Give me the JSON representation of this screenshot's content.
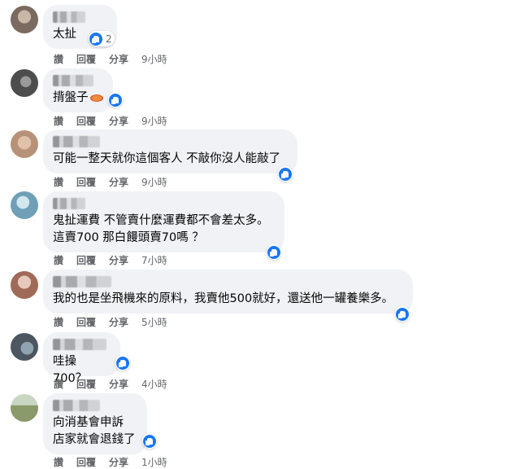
{
  "comments": [
    {
      "text": "太扯",
      "reaction_count": "2",
      "actions": {
        "like": "讚",
        "reply": "回覆",
        "share": "分享",
        "time": "9小時"
      },
      "avatar_color": "#7a6a60"
    },
    {
      "text": "揹盤子",
      "emoji": "plate-icon",
      "actions": {
        "like": "讚",
        "reply": "回覆",
        "share": "分享",
        "time": "9小時"
      },
      "avatar_color": "#5b5b5b"
    },
    {
      "text": "可能一整天就你這個客人 不敲你沒人能敲了",
      "actions": {
        "like": "讚",
        "reply": "回覆",
        "share": "分享",
        "time": "9小時"
      },
      "avatar_color": "#b89278"
    },
    {
      "text": "鬼扯運費 不管賣什麼運費都不會差太多。\n這賣700 那白饅頭賣70嗎 ？",
      "actions": {
        "like": "讚",
        "reply": "回覆",
        "share": "分享",
        "time": "7小時"
      },
      "avatar_color": "#6fa0b8"
    },
    {
      "text": "我的也是坐飛機來的原料，我賣他500就好，還送他一罐養樂多。",
      "actions": {
        "like": "讚",
        "reply": "回覆",
        "share": "分享",
        "time": "5小時"
      },
      "avatar_color": "#a06a58"
    },
    {
      "text": "哇操700？",
      "actions": {
        "like": "讚",
        "reply": "回覆",
        "share": "分享",
        "time": "4小時"
      },
      "avatar_color": "#4c5660"
    },
    {
      "text": "向消基會申訴\n店家就會退錢了",
      "actions": {
        "like": "讚",
        "reply": "回覆",
        "share": "分享",
        "time": "1小時"
      },
      "avatar_color": "#8a9a6a"
    }
  ],
  "colors": {
    "like_blue": "#1877f2",
    "bubble": "#f0f2f5",
    "meta": "#65676b"
  }
}
